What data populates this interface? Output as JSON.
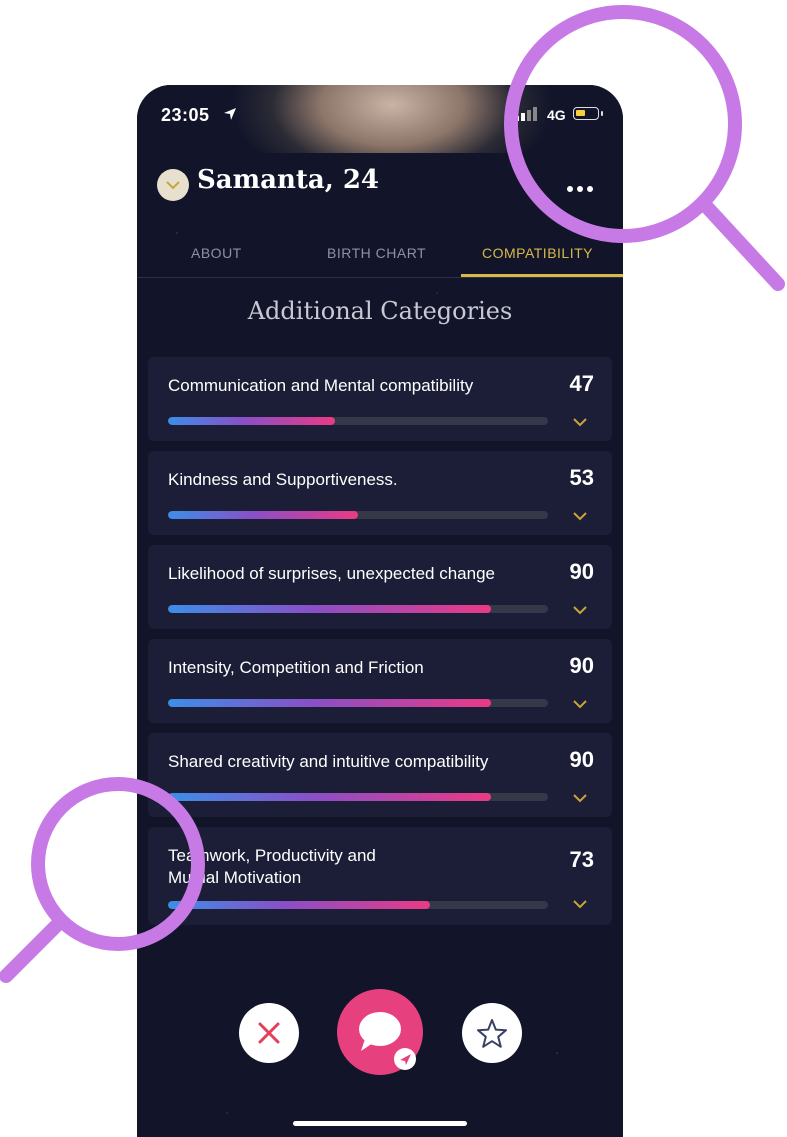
{
  "status": {
    "time": "23:05",
    "network": "4G"
  },
  "profile": {
    "name": "Samanta, 24"
  },
  "tabs": [
    {
      "label": "ABOUT",
      "active": false
    },
    {
      "label": "BIRTH CHART",
      "active": false
    },
    {
      "label": "COMPATIBILITY",
      "active": true
    }
  ],
  "section_title": "Additional Categories",
  "categories": [
    {
      "label": "Communication and Mental compatibility",
      "score": "47",
      "progress": 0.44
    },
    {
      "label": "Kindness and Supportiveness.",
      "score": "53",
      "progress": 0.5
    },
    {
      "label": "Likelihood of surprises, unexpected change",
      "score": "90",
      "progress": 0.85
    },
    {
      "label": "Intensity, Competition and Friction",
      "score": "90",
      "progress": 0.85
    },
    {
      "label": "Shared creativity and intuitive compatibility",
      "score": "90",
      "progress": 0.85
    },
    {
      "label": "Teamwork, Productivity and Mutual Motivation",
      "score": "73",
      "progress": 0.69
    }
  ],
  "colors": {
    "accent": "#d7b94a",
    "pink": "#e7407f",
    "bg": "#12152a",
    "card": "#1b1e36",
    "magnifier": "#c77ae6"
  },
  "icons": [
    "location-arrow-icon",
    "chevron-down-icon",
    "more-icon",
    "close-icon",
    "chat-bubble-icon",
    "send-icon",
    "star-icon",
    "magnifier-icon"
  ]
}
